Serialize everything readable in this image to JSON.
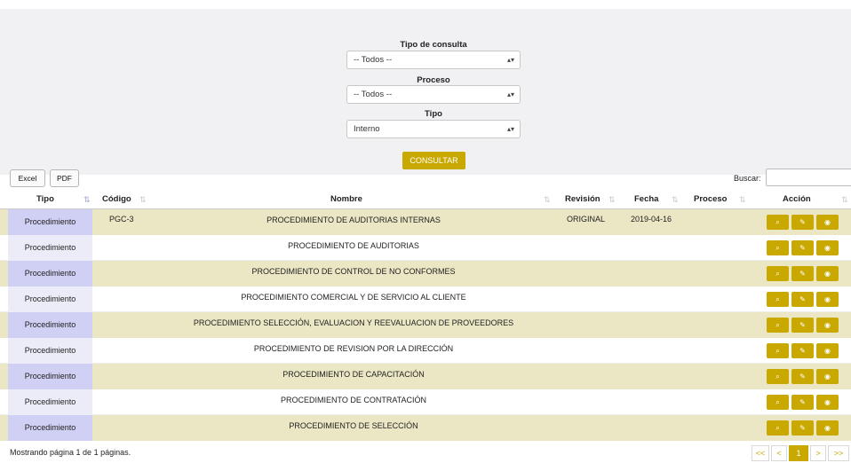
{
  "filters": {
    "tipo_consulta": {
      "label": "Tipo de consulta",
      "value": "-- Todos --"
    },
    "proceso": {
      "label": "Proceso",
      "value": "-- Todos --"
    },
    "tipo": {
      "label": "Tipo",
      "value": "Interno"
    },
    "submit_label": "CONSULTAR"
  },
  "toolbar": {
    "excel_label": "Excel",
    "pdf_label": "PDF",
    "search_label": "Buscar:",
    "search_value": ""
  },
  "table": {
    "columns": {
      "tipo": "Tipo",
      "codigo": "Código",
      "nombre": "Nombre",
      "revision": "Revisión",
      "fecha": "Fecha",
      "proceso": "Proceso",
      "accion": "Acción"
    },
    "sort_icons": {
      "active": "⇅",
      "inactive": "⇅"
    },
    "action_icons": {
      "view": "magnifier-icon",
      "edit": "edit-icon",
      "hide": "eye-slash-icon"
    },
    "rows": [
      {
        "tipo": "Procedimiento",
        "codigo": "PGC-3",
        "nombre": "PROCEDIMIENTO DE AUDITORIAS INTERNAS",
        "revision": "ORIGINAL",
        "fecha": "2019-04-16",
        "proceso": ""
      },
      {
        "tipo": "Procedimiento",
        "codigo": "",
        "nombre": "PROCEDIMIENTO DE AUDITORIAS",
        "revision": "",
        "fecha": "",
        "proceso": ""
      },
      {
        "tipo": "Procedimiento",
        "codigo": "",
        "nombre": "PROCEDIMIENTO DE CONTROL DE NO CONFORMES",
        "revision": "",
        "fecha": "",
        "proceso": ""
      },
      {
        "tipo": "Procedimiento",
        "codigo": "",
        "nombre": "PROCEDIMIENTO COMERCIAL Y DE SERVICIO AL CLIENTE",
        "revision": "",
        "fecha": "",
        "proceso": ""
      },
      {
        "tipo": "Procedimiento",
        "codigo": "",
        "nombre": "PROCEDIMIENTO SELECCIÓN, EVALUACION Y REEVALUACION DE PROVEEDORES",
        "revision": "",
        "fecha": "",
        "proceso": ""
      },
      {
        "tipo": "Procedimiento",
        "codigo": "",
        "nombre": "PROCEDIMIENTO DE REVISION POR LA DIRECCIÓN",
        "revision": "",
        "fecha": "",
        "proceso": ""
      },
      {
        "tipo": "Procedimiento",
        "codigo": "",
        "nombre": "PROCEDIMIENTO DE CAPACITACIÓN",
        "revision": "",
        "fecha": "",
        "proceso": ""
      },
      {
        "tipo": "Procedimiento",
        "codigo": "",
        "nombre": "PROCEDIMIENTO DE CONTRATACIÓN",
        "revision": "",
        "fecha": "",
        "proceso": ""
      },
      {
        "tipo": "Procedimiento",
        "codigo": "",
        "nombre": "PROCEDIMIENTO DE SELECCIÓN",
        "revision": "",
        "fecha": "",
        "proceso": ""
      }
    ]
  },
  "footer": {
    "info": "Mostrando página 1 de 1 páginas."
  },
  "pagination": {
    "first": "<<",
    "prev": "<",
    "current": "1",
    "next": ">",
    "last": ">>"
  },
  "colors": {
    "accent": "#c9a800",
    "row_alt": "#ebe7c4",
    "tipo_cell": "#d0cff4",
    "panel_bg": "#f1f1f3"
  }
}
